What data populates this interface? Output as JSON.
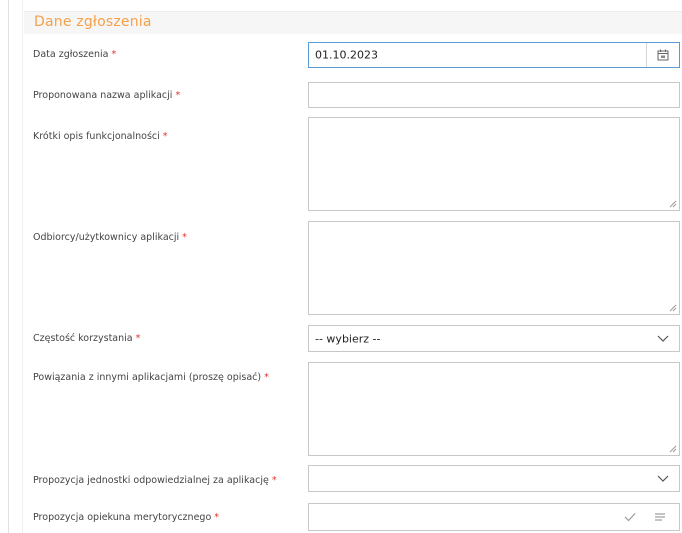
{
  "section": {
    "title": "Dane zgłoszenia"
  },
  "required_marker": "*",
  "fields": {
    "date": {
      "label": "Data zgłoszenia",
      "value": "01.10.2023",
      "icon": "calendar-icon"
    },
    "app_name": {
      "label": "Proponowana nazwa aplikacji",
      "value": ""
    },
    "description": {
      "label": "Krótki opis funkcjonalności",
      "value": ""
    },
    "recipients": {
      "label": "Odbiorcy/użytkownicy aplikacji",
      "value": ""
    },
    "frequency": {
      "label": "Częstość korzystania",
      "selected": "-- wybierz --"
    },
    "relations": {
      "label": "Powiązania z innymi aplikacjami (proszę opisać)",
      "value": ""
    },
    "unit": {
      "label": "Propozycja jednostki odpowiedzialnej za aplikację",
      "selected": ""
    },
    "guardian": {
      "label": "Propozycja opiekuna merytorycznego",
      "value": ""
    }
  },
  "colors": {
    "section_title": "#f6a04a",
    "required": "#e03030",
    "focus_border": "#5b9bd5"
  }
}
